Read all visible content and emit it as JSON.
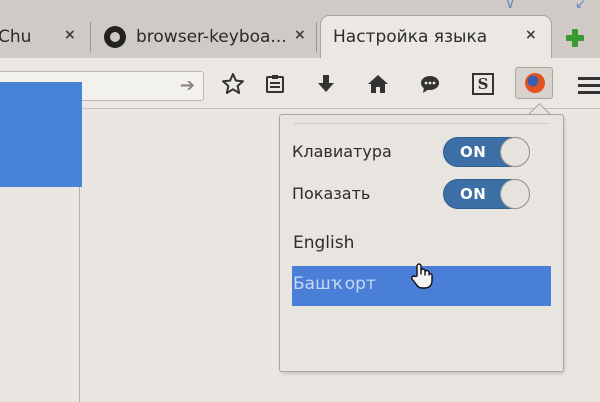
{
  "tabs": [
    {
      "title": "Chu",
      "close": "×",
      "active": false
    },
    {
      "title": "browser-keyboa...",
      "close": "×",
      "active": false,
      "icon": "github-icon"
    },
    {
      "title": "Настройка языка",
      "close": "×",
      "active": true
    }
  ],
  "toolbar": {
    "icons": [
      "go-arrow-icon",
      "bookmark-star-icon",
      "reading-list-icon",
      "download-icon",
      "home-icon",
      "chat-icon",
      "s-extension-icon",
      "firefox-icon",
      "menu-icon"
    ],
    "s_extension_glyph": "S"
  },
  "panel": {
    "settings": [
      {
        "label": "Клавиатура",
        "state": "ON"
      },
      {
        "label": "Показать",
        "state": "ON"
      }
    ],
    "languages": [
      {
        "label": "English",
        "selected": false
      },
      {
        "label": "Башҡорт",
        "selected": true
      }
    ]
  },
  "colors": {
    "accent_blue": "#4a7fd8",
    "toggle_on": "#3b6fa5",
    "newtab_green": "#3a9a31"
  }
}
